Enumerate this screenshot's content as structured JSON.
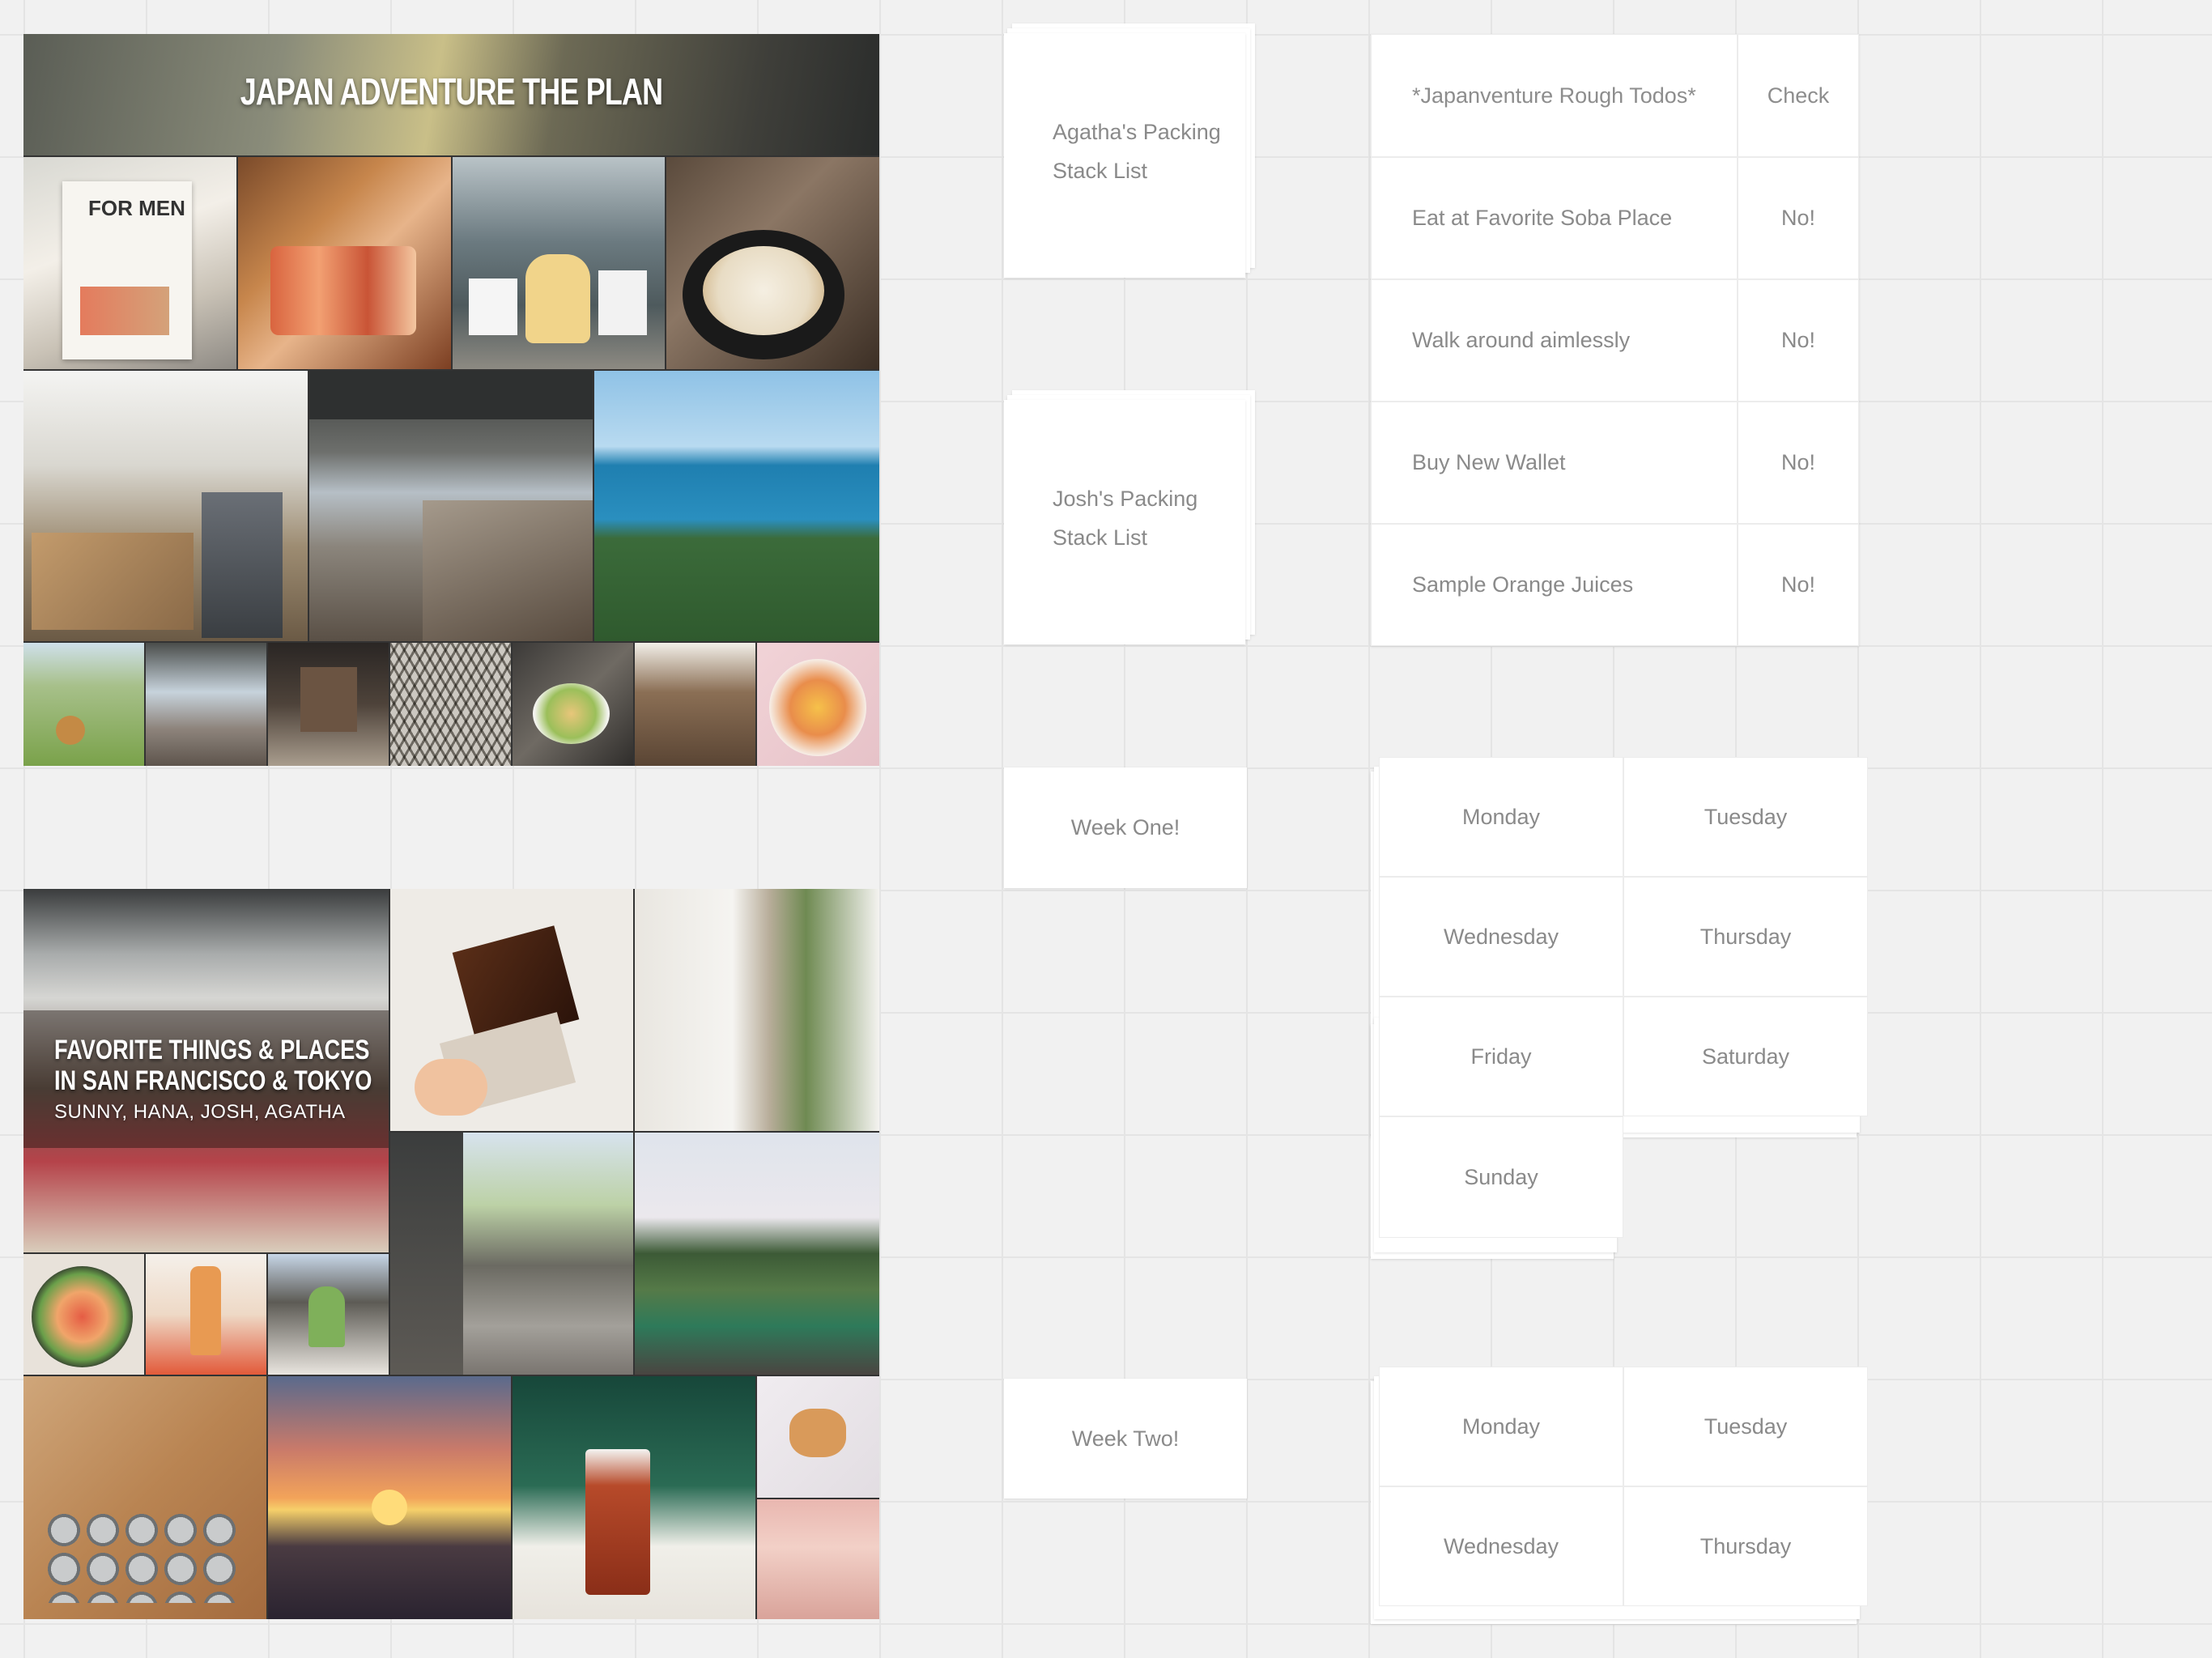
{
  "moodboard_1": {
    "title": "JAPAN ADVENTURE THE PLAN",
    "photos": [
      "magazine-photo",
      "sushi-photo",
      "shop-photo",
      "tempura-photo",
      "market-photo",
      "railway-photo",
      "ocean-photo",
      "dog-photo",
      "station-photo",
      "storefront-photo",
      "lattice-photo",
      "food-bowls-photo",
      "cafe-photo",
      "ramen-photo"
    ]
  },
  "moodboard_2": {
    "title_line1": "FAVORITE THINGS & PLACES",
    "title_line2": "IN SAN FRANCISCO & TOKYO",
    "subtitle": "SUNNY, HANA, JOSH, AGATHA",
    "photos": [
      "store-interior-photo",
      "cake-photo",
      "doorway-photo",
      "street-photo",
      "hillside-photo",
      "poke-bowl-photo",
      "bottles-photo",
      "matcha-photo",
      "kitchenware-photo",
      "sunset-photo",
      "iced-tea-photo",
      "dog-rug-photo",
      "pink-cafe-photo"
    ]
  },
  "cards": {
    "agatha_line1": "Agatha's Packing",
    "agatha_line2": "Stack List",
    "josh_line1": "Josh's Packing",
    "josh_line2": "Stack List",
    "week_one": "Week One!",
    "week_two": "Week Two!"
  },
  "todos": {
    "header": "*Japanventure Rough Todos*",
    "check_header": "Check",
    "rows": [
      {
        "task": "Eat at Favorite Soba Place",
        "status": "No!"
      },
      {
        "task": "Walk around aimlessly",
        "status": "No!"
      },
      {
        "task": "Buy New Wallet",
        "status": "No!"
      },
      {
        "task": "Sample Orange Juices",
        "status": "No!"
      }
    ]
  },
  "week_one_days": [
    "Monday",
    "Tuesday",
    "Wednesday",
    "Thursday",
    "Friday",
    "Saturday",
    "Sunday"
  ],
  "week_two_days": [
    "Monday",
    "Tuesday",
    "Wednesday",
    "Thursday"
  ],
  "colors": {
    "canvas": "#f1f1f1",
    "grid_line": "#e4e4e4",
    "card": "#ffffff",
    "card_text": "#8a8a8a"
  }
}
